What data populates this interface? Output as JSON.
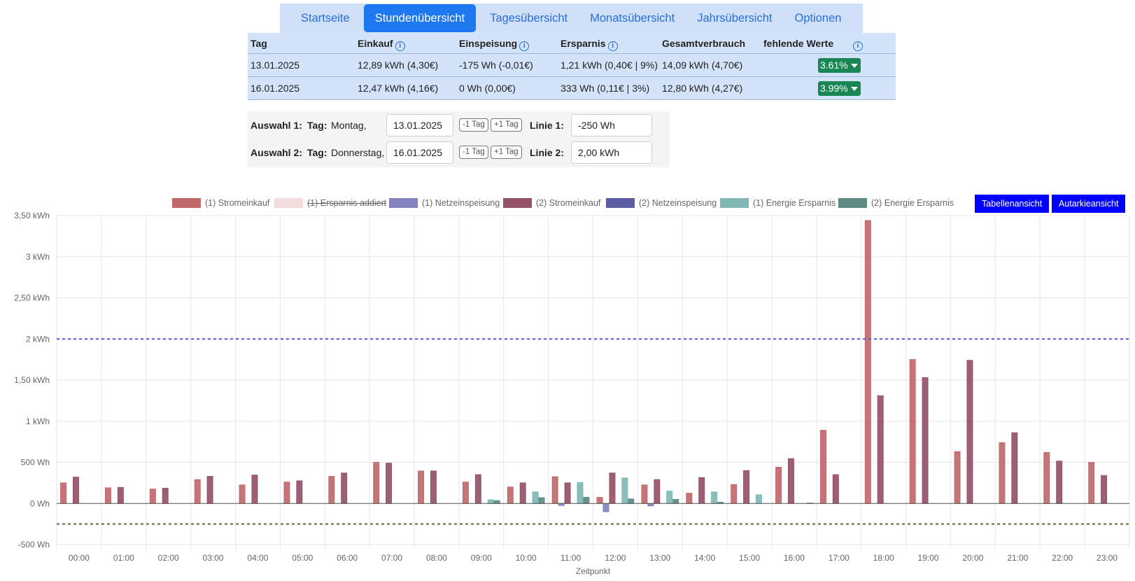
{
  "nav": {
    "items": [
      "Startseite",
      "Stundenübersicht",
      "Tagesübersicht",
      "Monatsübersicht",
      "Jahrsübersicht",
      "Optionen"
    ],
    "active_index": 1
  },
  "summary": {
    "headers": {
      "day": "Tag",
      "purchase": "Einkauf",
      "feed_in": "Einspeisung",
      "saving": "Ersparnis",
      "total": "Gesamtverbrauch",
      "missing": "fehlende Werte"
    },
    "rows": [
      {
        "day": "13.01.2025",
        "purchase": "12,89 kWh (4,30€)",
        "feed_in": "-175 Wh (-0,01€)",
        "saving": "1,21 kWh (0,40€ | 9%)",
        "total": "14,09 kWh (4,70€)",
        "missing": "3.61%"
      },
      {
        "day": "16.01.2025",
        "purchase": "12,47 kWh (4,16€)",
        "feed_in": "0 Wh (0,00€)",
        "saving": "333 Wh (0,11€ | 3%)",
        "total": "12,80 kWh (4,27€)",
        "missing": "3.99%"
      }
    ]
  },
  "selection": {
    "rows": [
      {
        "label": "Auswahl 1:",
        "day_label": "Tag:",
        "weekday": "Montag,",
        "date": "13.01.2025",
        "minus": "-1 Tag",
        "plus": "+1 Tag",
        "line_label": "Linie 1:",
        "line_value": "-250 Wh"
      },
      {
        "label": "Auswahl 2:",
        "day_label": "Tag:",
        "weekday": "Donnerstag,",
        "date": "16.01.2025",
        "minus": "-1 Tag",
        "plus": "+1 Tag",
        "line_label": "Linie 2:",
        "line_value": "2,00 kWh"
      }
    ]
  },
  "buttons": {
    "table_view": "Tabellenansicht",
    "autarky_view": "Autarkieansicht"
  },
  "colors": {
    "accent": "#1e78f0",
    "badge": "#198754",
    "view_button": "#0000ff"
  },
  "chart_data": {
    "type": "bar",
    "xlabel": "Zeitpunkt",
    "ylabel": "",
    "ylim": [
      -500,
      3500
    ],
    "yticks": [
      "-500 Wh",
      "0 Wh",
      "500 Wh",
      "1 kWh",
      "1,50 kWh",
      "2 kWh",
      "2,50 kWh",
      "3 kWh",
      "3,50 kWh"
    ],
    "categories": [
      "00:00",
      "01:00",
      "02:00",
      "03:00",
      "04:00",
      "05:00",
      "06:00",
      "07:00",
      "08:00",
      "09:00",
      "10:00",
      "11:00",
      "12:00",
      "13:00",
      "14:00",
      "15:00",
      "16:00",
      "17:00",
      "18:00",
      "19:00",
      "20:00",
      "21:00",
      "22:00",
      "23:00"
    ],
    "grid": true,
    "legend_position": "top",
    "series": [
      {
        "name": "(1) Stromeinkauf",
        "color": "#c0696b",
        "hidden": false,
        "values": [
          250,
          190,
          175,
          290,
          225,
          260,
          330,
          500,
          395,
          260,
          200,
          325,
          75,
          225,
          125,
          230,
          440,
          890,
          3440,
          1750,
          630,
          740,
          620,
          500
        ]
      },
      {
        "name": "(1) Ersparnis addiert",
        "color": "#f2dcdc",
        "hidden": true,
        "values": []
      },
      {
        "name": "(1) Netzeinspeisung",
        "color": "#8383c0",
        "hidden": false,
        "values": [
          0,
          0,
          0,
          0,
          0,
          0,
          0,
          0,
          0,
          0,
          0,
          -25,
          -100,
          -30,
          0,
          0,
          0,
          0,
          0,
          0,
          0,
          0,
          0,
          0
        ]
      },
      {
        "name": "(2) Stromeinkauf",
        "color": "#955168",
        "hidden": false,
        "values": [
          320,
          195,
          185,
          330,
          345,
          275,
          370,
          490,
          395,
          350,
          250,
          250,
          370,
          290,
          315,
          400,
          545,
          350,
          1310,
          1530,
          1740,
          860,
          515,
          340
        ]
      },
      {
        "name": "(2) Netzeinspeisung",
        "color": "#5d5da4",
        "hidden": false,
        "values": [
          0,
          0,
          0,
          0,
          0,
          0,
          0,
          0,
          0,
          0,
          0,
          0,
          0,
          0,
          0,
          0,
          0,
          0,
          0,
          0,
          0,
          0,
          0,
          0
        ]
      },
      {
        "name": "(1) Energie Ersparnis",
        "color": "#80b8b4",
        "hidden": false,
        "values": [
          0,
          0,
          0,
          0,
          0,
          0,
          0,
          0,
          0,
          45,
          140,
          255,
          310,
          150,
          140,
          105,
          0,
          0,
          0,
          0,
          0,
          0,
          0,
          0
        ]
      },
      {
        "name": "(2) Energie Ersparnis",
        "color": "#5e8a84",
        "hidden": false,
        "values": [
          0,
          0,
          0,
          0,
          0,
          0,
          0,
          0,
          0,
          35,
          70,
          75,
          55,
          50,
          15,
          0,
          5,
          0,
          0,
          0,
          0,
          0,
          0,
          0
        ]
      }
    ],
    "reference_lines": [
      {
        "value": 2000,
        "color": "#5555dd"
      },
      {
        "value": -250,
        "color": "#66663a"
      }
    ]
  }
}
